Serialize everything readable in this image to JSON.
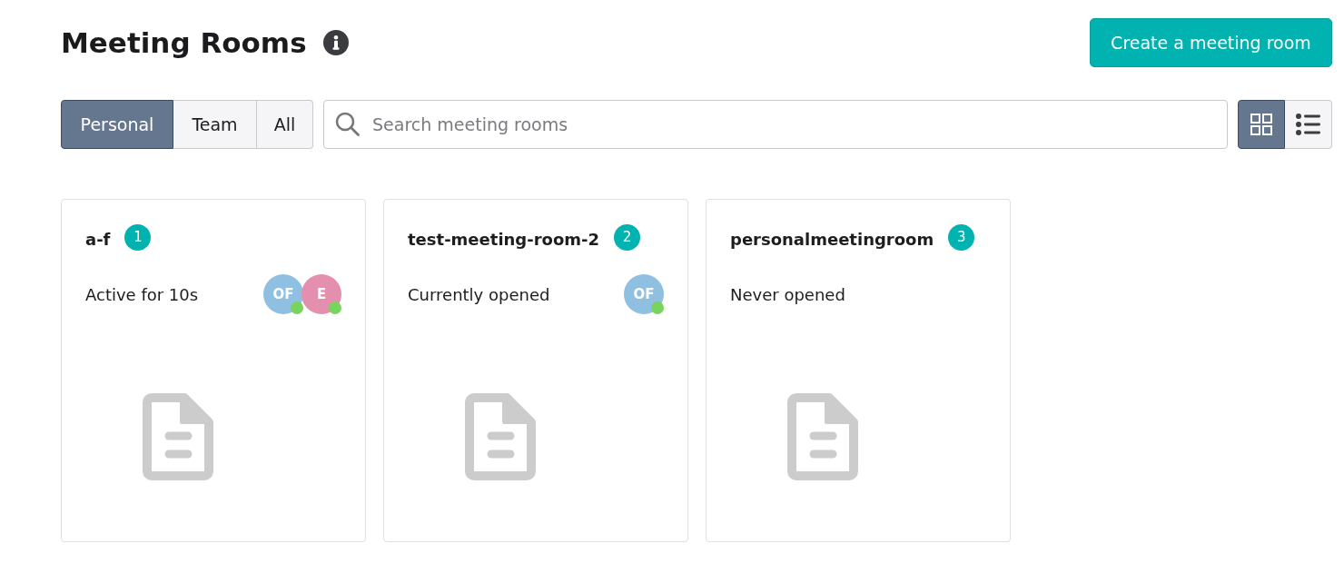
{
  "header": {
    "title": "Meeting Rooms",
    "create_button": "Create a meeting room"
  },
  "filters": [
    {
      "label": "Personal",
      "selected": true
    },
    {
      "label": "Team",
      "selected": false
    },
    {
      "label": "All",
      "selected": false
    }
  ],
  "search": {
    "placeholder": "Search meeting rooms"
  },
  "view_toggle": [
    {
      "kind": "grid",
      "selected": true
    },
    {
      "kind": "list",
      "selected": false
    }
  ],
  "rooms": [
    {
      "name": "a-f",
      "badge": "1",
      "status": "Active for 10s",
      "participants": [
        {
          "initials": "OF",
          "color": "#8fbfe1",
          "online": true
        },
        {
          "initials": "E",
          "color": "#e38fad",
          "online": true
        }
      ]
    },
    {
      "name": "test-meeting-room-2",
      "badge": "2",
      "status": "Currently opened",
      "participants": [
        {
          "initials": "OF",
          "color": "#8fbfe1",
          "online": true
        }
      ]
    },
    {
      "name": "personalmeetingroom",
      "badge": "3",
      "status": "Never opened"
    }
  ]
}
